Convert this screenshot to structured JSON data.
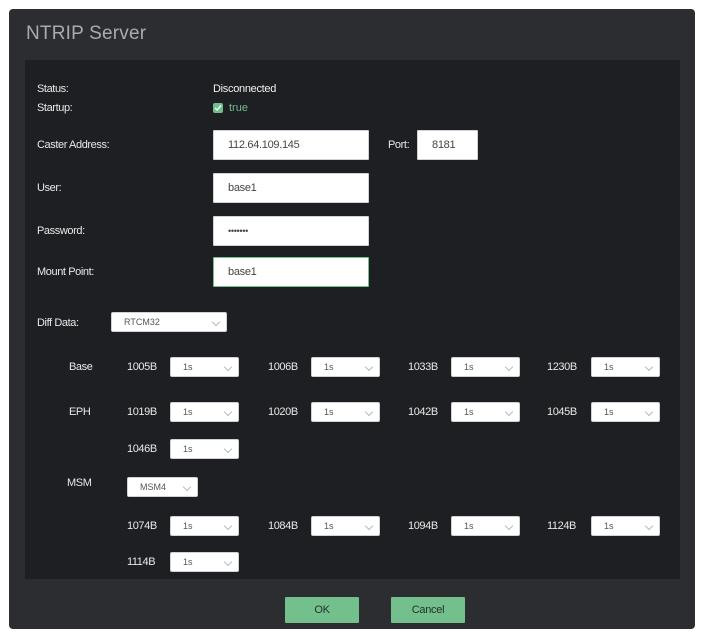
{
  "dialog": {
    "title": "NTRIP Server"
  },
  "form": {
    "status_label": "Status:",
    "status_value": "Disconnected",
    "startup_label": "Startup:",
    "startup_checked": true,
    "startup_value": "true",
    "caster_label": "Caster Address:",
    "caster_value": "112.64.109.145",
    "port_label": "Port:",
    "port_value": "8181",
    "user_label": "User:",
    "user_value": "base1",
    "password_label": "Password:",
    "password_value": "•••••••",
    "mount_label": "Mount Point:",
    "mount_value": "base1",
    "diff_label": "Diff Data:",
    "diff_value": "RTCM32"
  },
  "groups": {
    "base_label": "Base",
    "eph_label": "EPH",
    "msm_label": "MSM",
    "msm_value": "MSM4"
  },
  "messages": {
    "base": [
      {
        "id": "1005B",
        "rate": "1s"
      },
      {
        "id": "1006B",
        "rate": "1s"
      },
      {
        "id": "1033B",
        "rate": "1s"
      },
      {
        "id": "1230B",
        "rate": "1s"
      }
    ],
    "eph": [
      {
        "id": "1019B",
        "rate": "1s"
      },
      {
        "id": "1020B",
        "rate": "1s"
      },
      {
        "id": "1042B",
        "rate": "1s"
      },
      {
        "id": "1045B",
        "rate": "1s"
      },
      {
        "id": "1046B",
        "rate": "1s"
      }
    ],
    "msm": [
      {
        "id": "1074B",
        "rate": "1s"
      },
      {
        "id": "1084B",
        "rate": "1s"
      },
      {
        "id": "1094B",
        "rate": "1s"
      },
      {
        "id": "1124B",
        "rate": "1s"
      },
      {
        "id": "1114B",
        "rate": "1s"
      }
    ]
  },
  "buttons": {
    "ok_label": "OK",
    "cancel_label": "Cancel"
  },
  "colors": {
    "accent": "#73c08c",
    "dialog_bg": "#2b2d31",
    "panel_bg": "#1e1f22"
  }
}
